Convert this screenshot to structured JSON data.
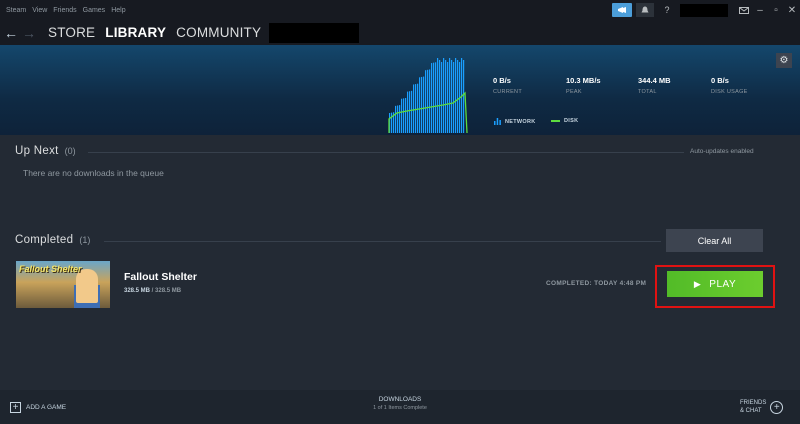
{
  "menu": [
    "Steam",
    "View",
    "Friends",
    "Games",
    "Help"
  ],
  "titlebar": {
    "announce_icon": "megaphone-icon",
    "bell_icon": "bell-icon",
    "help_label": "?",
    "envelope_icon": "envelope-icon",
    "minimize": "–",
    "maximize": "▫",
    "close": "✕"
  },
  "nav": {
    "back": "←",
    "forward": "→",
    "links": [
      "STORE",
      "LIBRARY",
      "COMMUNITY"
    ],
    "active": "LIBRARY"
  },
  "stats": [
    {
      "value": "0 B/s",
      "label": "CURRENT"
    },
    {
      "value": "10.3 MB/s",
      "label": "PEAK"
    },
    {
      "value": "344.4 MB",
      "label": "TOTAL"
    },
    {
      "value": "0 B/s",
      "label": "DISK USAGE"
    }
  ],
  "legend": {
    "network": "NETWORK",
    "disk": "DISK",
    "network_color": "#1a9fff",
    "disk_color": "#5ddc3f"
  },
  "up_next": {
    "title": "Up Next",
    "count": "(0)",
    "auto_updates": "Auto-updates enabled",
    "empty": "There are no downloads in the queue"
  },
  "completed": {
    "title": "Completed",
    "count": "(1)",
    "clear_all": "Clear All"
  },
  "game": {
    "thumb_title": "Fallout Shelter",
    "name": "Fallout Shelter",
    "downloaded": "328.5 MB",
    "size_sep": " / ",
    "total": "328.5 MB",
    "completed_text": "COMPLETED: TODAY 4:48 PM",
    "play_label": "PLAY",
    "play_icon": "▶"
  },
  "bottom": {
    "add_game": "ADD A GAME",
    "downloads_title": "DOWNLOADS",
    "downloads_sub": "1 of 1 Items Complete",
    "friends_line1": "FRIENDS",
    "friends_line2": "& CHAT"
  },
  "colors": {
    "accent": "#1a9fff",
    "play_green": "#5ec32c",
    "highlight_red": "#e01212"
  }
}
